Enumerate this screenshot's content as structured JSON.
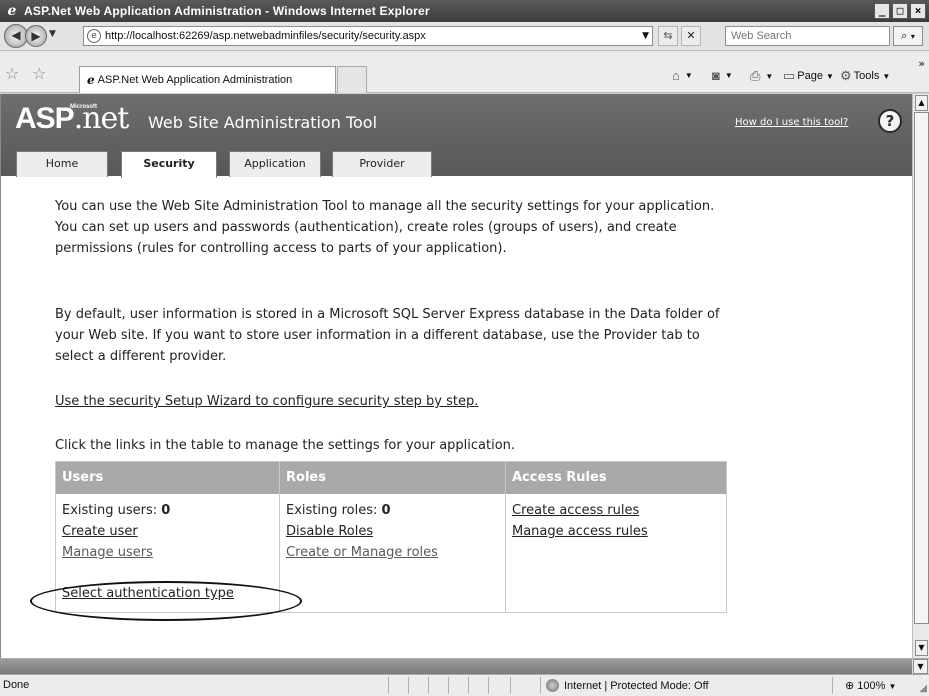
{
  "window": {
    "title": "ASP.Net Web Application Administration - Windows Internet Explorer",
    "minimize": "_",
    "maximize": "□",
    "close": "×"
  },
  "addressbar": {
    "url": "http://localhost:62269/asp.netwebadminfiles/security/security.aspx",
    "search_placeholder": "Web Search"
  },
  "commandbar": {
    "tab_title": "ASP.Net Web Application Administration",
    "page_label": "Page",
    "tools_label": "Tools"
  },
  "page": {
    "logo_text": "ASP",
    "logo_net": ".net",
    "logo_ms": "Microsoft",
    "site_title": "Web Site Administration Tool",
    "help_link": "How do I use this tool?",
    "tabs": [
      {
        "label": "Home"
      },
      {
        "label": "Security"
      },
      {
        "label": "Application"
      },
      {
        "label": "Provider"
      }
    ],
    "intro": "You can use the Web Site Administration Tool to manage all the security settings for your application. You can set up users and passwords (authentication), create roles (groups of users), and create permissions (rules for controlling access to parts of your application).",
    "default_info": "By default, user information is stored in a Microsoft SQL Server Express database in the Data folder of your Web site. If you want to store user information in a different database, use the Provider tab to select a different provider.",
    "wizard_link": "Use the security Setup Wizard to configure security step by step.",
    "table_intro": "Click the links in the table to manage the settings for your application.",
    "users": {
      "header": "Users",
      "existing_label": "Existing users: ",
      "existing_count": "0",
      "create": "Create user",
      "manage": "Manage users",
      "auth_type": "Select authentication type"
    },
    "roles": {
      "header": "Roles",
      "existing_label": "Existing roles: ",
      "existing_count": "0",
      "disable": "Disable Roles",
      "manage": "Create or Manage roles"
    },
    "access": {
      "header": "Access Rules",
      "create": "Create access rules",
      "manage": "Manage access rules"
    }
  },
  "statusbar": {
    "status": "Done",
    "zone": "Internet | Protected Mode: Off",
    "zoom": "100%"
  }
}
